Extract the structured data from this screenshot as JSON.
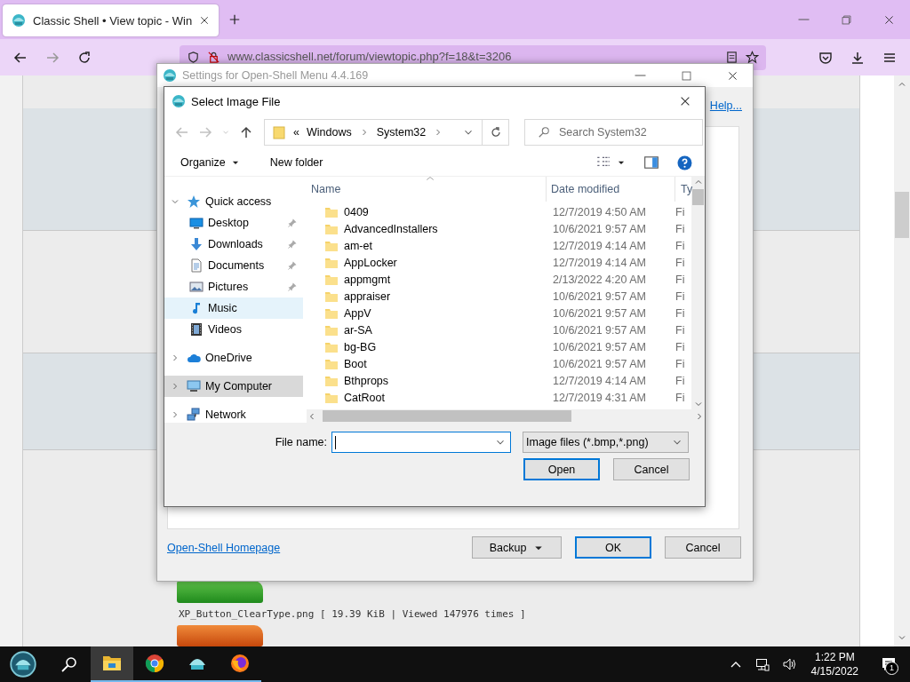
{
  "browser": {
    "tabs": [
      {
        "title": "Classic Shell • View topic - Win",
        "selected": true
      }
    ],
    "url": "www.classicshell.net/forum/viewtopic.php?f=18&t=3206"
  },
  "forum": {
    "attachment_caption": "XP_Button_ClearType.png [ 19.39 KiB | Viewed 147976 times ]"
  },
  "settings_window": {
    "title": "Settings for Open-Shell Menu 4.4.169",
    "help_link": "Help...",
    "homepage_link": "Open-Shell Homepage",
    "buttons": [
      {
        "label": "Backup",
        "kind": "split",
        "default": false
      },
      {
        "label": "OK",
        "kind": "push",
        "default": true
      },
      {
        "label": "Cancel",
        "kind": "push",
        "default": false
      }
    ]
  },
  "dialog": {
    "title": "Select Image File",
    "overflow_mark": "«",
    "path": [
      "Windows",
      "System32"
    ],
    "search_placeholder": "Search System32",
    "organize": "Organize",
    "new_folder": "New folder",
    "nav": [
      {
        "label": "Quick access",
        "kind": "star",
        "expanded": true,
        "selected": false,
        "highlighted": false,
        "children": [
          {
            "label": "Desktop",
            "kind": "desktop",
            "pinned": true,
            "selected": false,
            "highlighted": false
          },
          {
            "label": "Downloads",
            "kind": "download",
            "pinned": true,
            "selected": false,
            "highlighted": false
          },
          {
            "label": "Documents",
            "kind": "document",
            "pinned": true,
            "selected": false,
            "highlighted": false
          },
          {
            "label": "Pictures",
            "kind": "picture",
            "pinned": true,
            "selected": false,
            "highlighted": false
          },
          {
            "label": "Music",
            "kind": "music",
            "pinned": false,
            "selected": false,
            "highlighted": true
          },
          {
            "label": "Videos",
            "kind": "video",
            "pinned": false,
            "selected": false,
            "highlighted": false
          }
        ]
      },
      {
        "label": "OneDrive",
        "kind": "cloud",
        "expanded": false,
        "selected": false,
        "highlighted": false
      },
      {
        "label": "My Computer",
        "kind": "computer",
        "expanded": false,
        "selected": true,
        "highlighted": false
      },
      {
        "label": "Network",
        "kind": "network",
        "expanded": false,
        "selected": false,
        "highlighted": false
      }
    ],
    "columns": [
      "Name",
      "Date modified",
      "Ty"
    ],
    "files": [
      {
        "name": "0409",
        "date": "12/7/2019 4:50 AM",
        "type": "Fi"
      },
      {
        "name": "AdvancedInstallers",
        "date": "10/6/2021 9:57 AM",
        "type": "Fi"
      },
      {
        "name": "am-et",
        "date": "12/7/2019 4:14 AM",
        "type": "Fi"
      },
      {
        "name": "AppLocker",
        "date": "12/7/2019 4:14 AM",
        "type": "Fi"
      },
      {
        "name": "appmgmt",
        "date": "2/13/2022 4:20 AM",
        "type": "Fi"
      },
      {
        "name": "appraiser",
        "date": "10/6/2021 9:57 AM",
        "type": "Fi"
      },
      {
        "name": "AppV",
        "date": "10/6/2021 9:57 AM",
        "type": "Fi"
      },
      {
        "name": "ar-SA",
        "date": "10/6/2021 9:57 AM",
        "type": "Fi"
      },
      {
        "name": "bg-BG",
        "date": "10/6/2021 9:57 AM",
        "type": "Fi"
      },
      {
        "name": "Boot",
        "date": "10/6/2021 9:57 AM",
        "type": "Fi"
      },
      {
        "name": "Bthprops",
        "date": "12/7/2019 4:14 AM",
        "type": "Fi"
      },
      {
        "name": "CatRoot",
        "date": "12/7/2019 4:31 AM",
        "type": "Fi"
      }
    ],
    "file_name_label": "File name:",
    "filter": "Image files (*.bmp,*.png)",
    "buttons": [
      {
        "label": "Open",
        "default": true
      },
      {
        "label": "Cancel",
        "default": false
      }
    ]
  },
  "taskbar": {
    "apps": [
      {
        "kind": "explorer",
        "active": true
      },
      {
        "kind": "chrome",
        "active": false
      },
      {
        "kind": "shell",
        "active": false
      },
      {
        "kind": "firefox",
        "active": false
      }
    ],
    "time": "1:22 PM",
    "date": "4/15/2022",
    "notifications": "1"
  }
}
